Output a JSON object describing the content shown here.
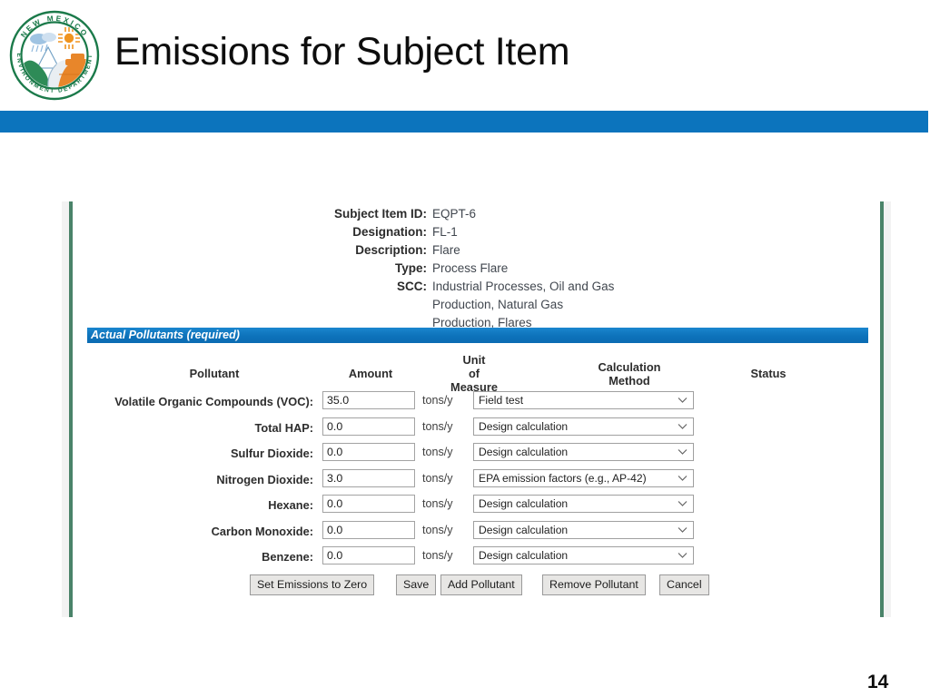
{
  "slide": {
    "title": "Emissions for Subject Item",
    "page_number": "14",
    "accent_blue": "#0c74bd",
    "panel_edge_green": "#4a8369"
  },
  "logo": {
    "name": "new-mexico-environment-department-seal",
    "top_text": "NEW MEXICO",
    "bottom_text": "ENVIRONMENT DEPARTMENT",
    "ring_color": "#1b7a4a",
    "hill_color": "#2e8b57",
    "mesa_color": "#e8862a",
    "sun_color": "#f0941f",
    "cloud_color": "#8fb8dd"
  },
  "subject": {
    "rows": [
      {
        "label": "Subject Item ID:",
        "value": "EQPT-6",
        "cont": []
      },
      {
        "label": "Designation:",
        "value": "FL-1",
        "cont": []
      },
      {
        "label": "Description:",
        "value": "Flare",
        "cont": []
      },
      {
        "label": "Type:",
        "value": "Process Flare",
        "cont": []
      },
      {
        "label": "SCC:",
        "value": "Industrial Processes, Oil and Gas",
        "cont": [
          "Production, Natural Gas",
          "Production, Flares"
        ]
      }
    ]
  },
  "section": {
    "title": "Actual Pollutants (required)",
    "bar_color": "#0d72ba"
  },
  "table": {
    "headers": {
      "pollutant": "Pollutant",
      "amount": "Amount",
      "unit_line1": "Unit",
      "unit_line2": "of",
      "unit_line3": "Measure",
      "method_line1": "Calculation",
      "method_line2": "Method",
      "status": "Status"
    },
    "rows": [
      {
        "pollutant": "Volatile Organic Compounds (VOC):",
        "amount": "35.0",
        "uom": "tons/y",
        "method": "Field test",
        "status": ""
      },
      {
        "pollutant": "Total HAP:",
        "amount": "0.0",
        "uom": "tons/y",
        "method": "Design calculation",
        "status": ""
      },
      {
        "pollutant": "Sulfur Dioxide:",
        "amount": "0.0",
        "uom": "tons/y",
        "method": "Design calculation",
        "status": ""
      },
      {
        "pollutant": "Nitrogen Dioxide:",
        "amount": "3.0",
        "uom": "tons/y",
        "method": "EPA emission factors (e.g., AP-42)",
        "status": ""
      },
      {
        "pollutant": "Hexane:",
        "amount": "0.0",
        "uom": "tons/y",
        "method": "Design calculation",
        "status": ""
      },
      {
        "pollutant": "Carbon Monoxide:",
        "amount": "0.0",
        "uom": "tons/y",
        "method": "Design calculation",
        "status": ""
      },
      {
        "pollutant": "Benzene:",
        "amount": "0.0",
        "uom": "tons/y",
        "method": "Design calculation",
        "status": ""
      }
    ]
  },
  "buttons": {
    "set_zero": "Set Emissions to Zero",
    "save": "Save",
    "add_pollutant": "Add Pollutant",
    "remove_pollutant": "Remove Pollutant",
    "cancel": "Cancel"
  }
}
